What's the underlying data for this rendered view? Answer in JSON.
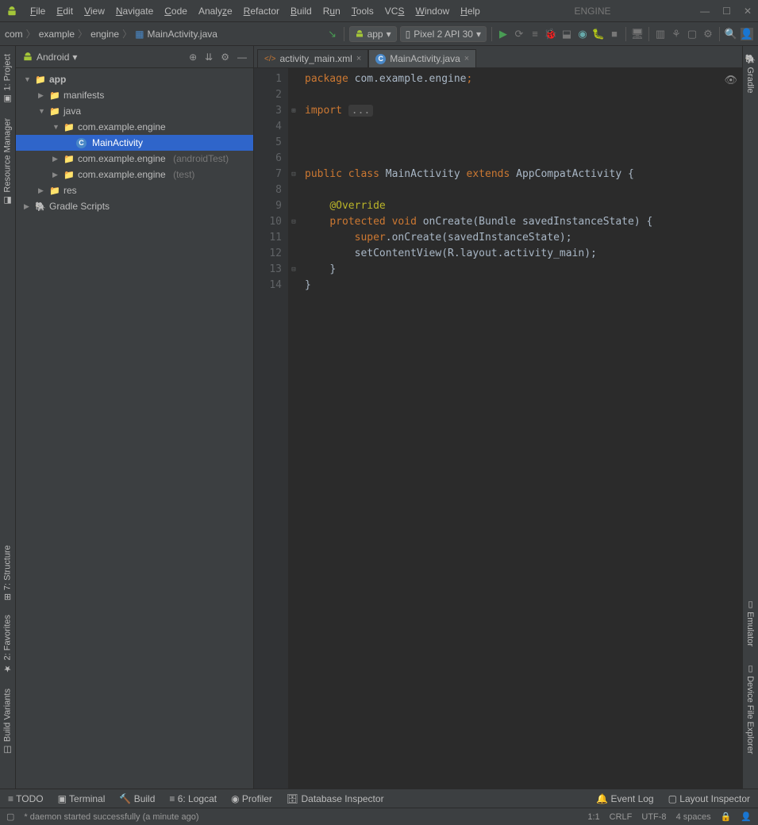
{
  "app_title": "ENGINE",
  "menu": [
    "File",
    "Edit",
    "View",
    "Navigate",
    "Code",
    "Analyze",
    "Refactor",
    "Build",
    "Run",
    "Tools",
    "VCS",
    "Window",
    "Help"
  ],
  "breadcrumb": [
    "com",
    "example",
    "engine",
    "MainActivity.java"
  ],
  "run_config": "app",
  "device": "Pixel 2 API 30",
  "sidebar": {
    "title": "Android",
    "tree": {
      "app": "app",
      "manifests": "manifests",
      "java": "java",
      "pkg1": "com.example.engine",
      "main_activity": "MainActivity",
      "pkg2": "com.example.engine",
      "pkg2_suffix": "(androidTest)",
      "pkg3": "com.example.engine",
      "pkg3_suffix": "(test)",
      "res": "res",
      "gradle": "Gradle Scripts"
    }
  },
  "left_tabs": [
    "1: Project",
    "Resource Manager",
    "7: Structure",
    "2: Favorites",
    "Build Variants"
  ],
  "right_tabs": [
    "Gradle",
    "Emulator",
    "Device File Explorer"
  ],
  "editor_tabs": [
    {
      "label": "activity_main.xml",
      "active": false
    },
    {
      "label": "MainActivity.java",
      "active": true
    }
  ],
  "code_lines": [
    "1",
    "2",
    "3",
    "4",
    "5",
    "6",
    "7",
    "8",
    "9",
    "10",
    "11",
    "12",
    "13",
    "14"
  ],
  "code": {
    "pkg_kw": "package",
    "pkg_name": " com.example.engine",
    "import_kw": "import",
    "dots": "...",
    "public": "public",
    "class": "class",
    "classname": " MainActivity ",
    "extends": "extends",
    "superclass": " AppCompatActivity {",
    "override": "@Override",
    "protected": "protected",
    "void": "void",
    "method": " onCreate(Bundle savedInstanceState) {",
    "super_kw": "super",
    "super_call": ".onCreate(savedInstanceState);",
    "setview": "setContentView(R.layout.activity_main);",
    "close1": "}",
    "close2": "}"
  },
  "bottom_tools": [
    "TODO",
    "Terminal",
    "Build",
    "6: Logcat",
    "Profiler",
    "Database Inspector"
  ],
  "bottom_right": [
    "Event Log",
    "Layout Inspector"
  ],
  "status": {
    "msg": "* daemon started successfully (a minute ago)",
    "pos": "1:1",
    "eol": "CRLF",
    "enc": "UTF-8",
    "indent": "4 spaces"
  }
}
